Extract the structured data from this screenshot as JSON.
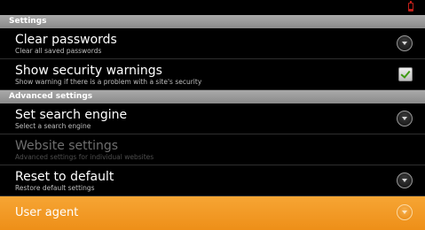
{
  "status_bar": {
    "battery_icon": "battery-low-icon",
    "battery_color": "#c2201a"
  },
  "sections": {
    "general_header": "Settings",
    "advanced_header": "Advanced settings"
  },
  "preferences": {
    "clear_passwords": {
      "title": "Clear passwords",
      "summary": "Clear all saved passwords",
      "widget": "chevron-down-icon"
    },
    "security_warnings": {
      "title": "Show security warnings",
      "summary": "Show warning if there is a problem with a site's security",
      "checked": true,
      "widget": "checkbox-icon"
    },
    "search_engine": {
      "title": "Set search engine",
      "summary": "Select a search engine",
      "widget": "chevron-down-icon"
    },
    "website_settings": {
      "title": "Website settings",
      "summary": "Advanced settings for individual websites",
      "enabled": false
    },
    "reset_default": {
      "title": "Reset to default",
      "summary": "Restore default settings",
      "widget": "chevron-down-icon"
    },
    "user_agent": {
      "title": "User agent",
      "selected": true,
      "widget": "chevron-down-icon"
    }
  },
  "colors": {
    "highlight": "#f39c26",
    "check": "#3f9a12",
    "header_bg": "#9c9c9c"
  }
}
